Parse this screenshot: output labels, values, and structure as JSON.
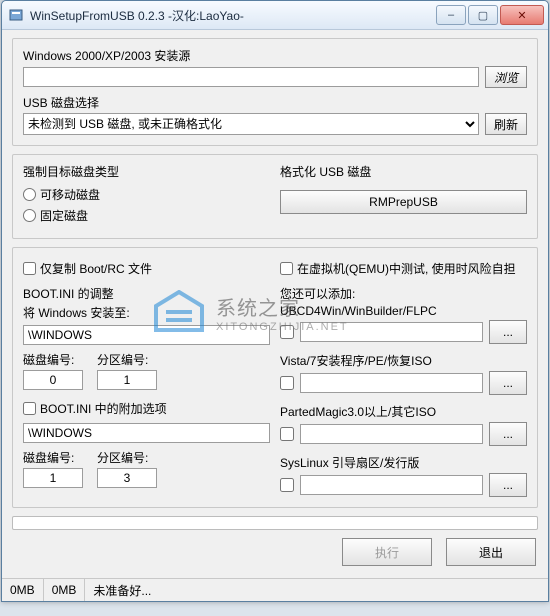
{
  "window": {
    "title": "WinSetupFromUSB 0.2.3 -汉化:LaoYao-"
  },
  "src": {
    "label": "Windows 2000/XP/2003 安装源",
    "value": "",
    "browse": "浏览"
  },
  "usb": {
    "label": "USB 磁盘选择",
    "select_value": "未检测到 USB 磁盘, 或未正确格式化",
    "refresh": "刷新"
  },
  "force": {
    "legend": "强制目标磁盘类型",
    "opt_removable": "可移动磁盘",
    "opt_fixed": "固定磁盘"
  },
  "format": {
    "legend": "格式化 USB 磁盘",
    "rmprep": "RMPrepUSB"
  },
  "copy_bootrc": "仅复制 Boot/RC 文件",
  "qemu_test": "在虚拟机(QEMU)中测试, 使用时风险自担",
  "bootini": {
    "legend": "BOOT.INI 的调整",
    "install_label": "将 Windows 安装至:",
    "install_value": "\\WINDOWS",
    "disk_label": "磁盘编号:",
    "part_label": "分区编号:",
    "disk1": "0",
    "part1": "1",
    "extra_check": "BOOT.INI 中的附加选项",
    "extra_value": "\\WINDOWS",
    "disk2": "1",
    "part2": "3"
  },
  "extras": {
    "legend": "您还可以添加:",
    "ubcd": "UBCD4Win/WinBuilder/FLPC",
    "ubcd_value": "",
    "vista": "Vista/7安装程序/PE/恢复ISO",
    "vista_value": "",
    "parted": "PartedMagic3.0以上/其它ISO",
    "parted_value": "",
    "syslinux": "SysLinux 引导扇区/发行版",
    "syslinux_value": "",
    "dots": "..."
  },
  "actions": {
    "execute": "执行",
    "exit": "退出"
  },
  "status": {
    "mb1": "0MB",
    "mb2": "0MB",
    "msg": "未准备好..."
  },
  "watermark": {
    "text": "系统之家",
    "sub": "XITONGZHIJIA.NET"
  }
}
